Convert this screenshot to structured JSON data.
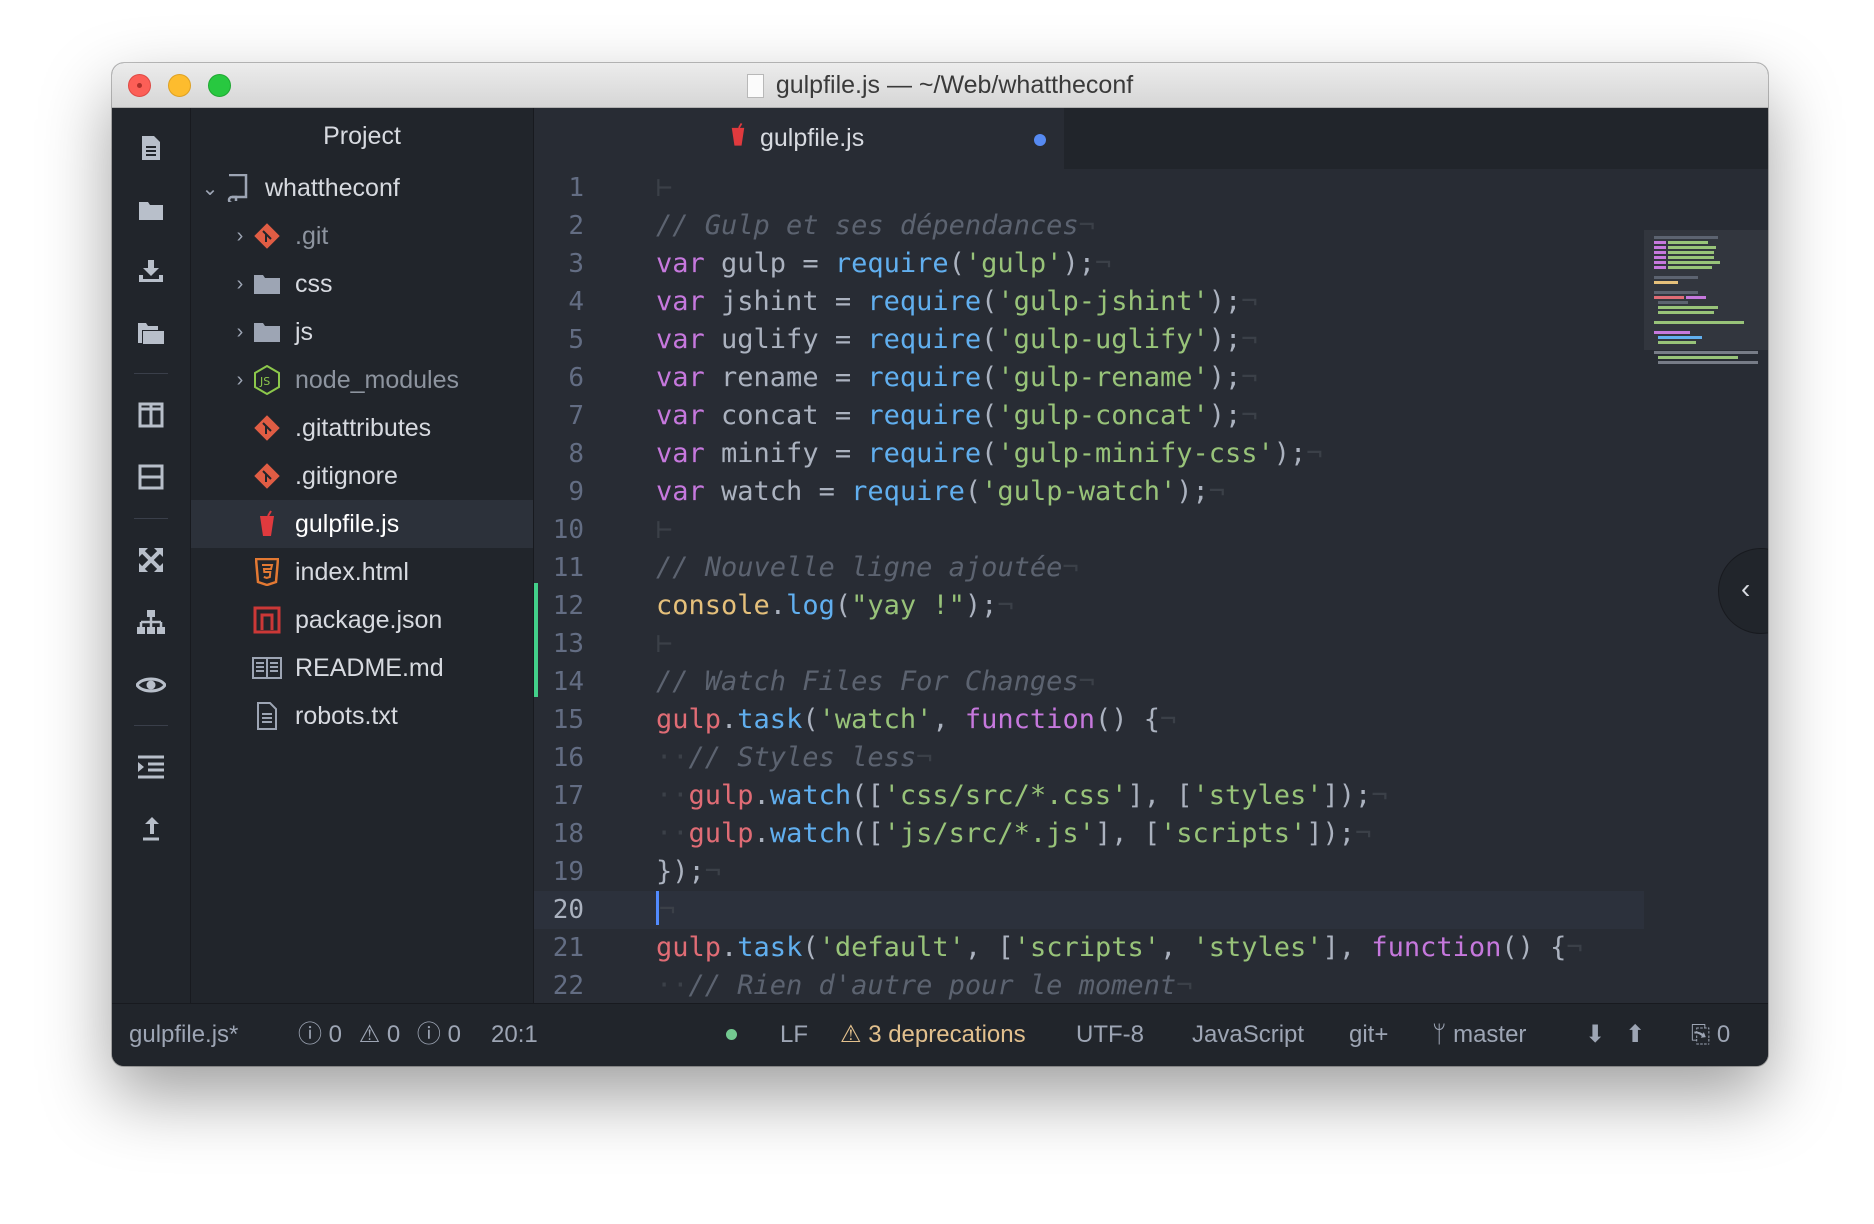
{
  "window": {
    "title": "gulpfile.js — ~/Web/whattheconf"
  },
  "tree": {
    "header": "Project",
    "root": "whattheconf",
    "items": [
      {
        "label": ".git",
        "icon": "git-repo-icon"
      },
      {
        "label": "css",
        "icon": "folder-icon"
      },
      {
        "label": "js",
        "icon": "folder-icon"
      },
      {
        "label": "node_modules",
        "icon": "nodejs-icon"
      },
      {
        "label": ".gitattributes",
        "icon": "git-icon"
      },
      {
        "label": ".gitignore",
        "icon": "git-icon"
      },
      {
        "label": "gulpfile.js",
        "icon": "gulp-icon"
      },
      {
        "label": "index.html",
        "icon": "html5-icon"
      },
      {
        "label": "package.json",
        "icon": "npm-icon"
      },
      {
        "label": "README.md",
        "icon": "readme-icon"
      },
      {
        "label": "robots.txt",
        "icon": "text-file-icon"
      }
    ]
  },
  "editor": {
    "tab": {
      "label": "gulpfile.js",
      "modified": true
    },
    "line_numbers": [
      "1",
      "2",
      "3",
      "4",
      "5",
      "6",
      "7",
      "8",
      "9",
      "10",
      "11",
      "12",
      "13",
      "14",
      "15",
      "16",
      "17",
      "18",
      "19",
      "20",
      "21",
      "22"
    ],
    "code": {
      "l2": "// Gulp et ses dépendances",
      "var": "var",
      "eq": " = ",
      "require": "require",
      "l3_name": " gulp",
      "l3_str": "'gulp'",
      "l4_name": " jshint",
      "l4_str": "'gulp-jshint'",
      "l5_name": " uglify",
      "l5_str": "'gulp-uglify'",
      "l6_name": " rename",
      "l6_str": "'gulp-rename'",
      "l7_name": " concat",
      "l7_str": "'gulp-concat'",
      "l8_name": " minify",
      "l8_str": "'gulp-minify-css'",
      "l9_name": " watch",
      "l9_str": "'gulp-watch'",
      "l11": "// Nouvelle ligne ajoutée",
      "l12_obj": "console",
      "l12_fn": "log",
      "l12_str": "\"yay !\"",
      "l14": "// Watch Files For Changes",
      "gulp": "gulp",
      "task": "task",
      "watch": "watch",
      "function": "function",
      "l15_str": "'watch'",
      "l16": "// Styles less",
      "l17_a": "'css/src/*.css'",
      "l17_b": "'styles'",
      "l18_a": "'js/src/*.js'",
      "l18_b": "'scripts'",
      "l19": "});",
      "l21_a": "'default'",
      "l21_b": "'scripts'",
      "l21_c": "'styles'",
      "l22": "// Rien d'autre pour le moment"
    }
  },
  "status": {
    "file": "gulpfile.js*",
    "errors": "0",
    "warnings": "0",
    "infos": "0",
    "cursor": "20:1",
    "line_ending": "LF",
    "deprecations": "3 deprecations",
    "encoding": "UTF-8",
    "grammar": "JavaScript",
    "git": "git+",
    "branch": "master",
    "pending": "0"
  },
  "colors": {
    "keyword": "#c678dd",
    "function": "#61afef",
    "string": "#98c379",
    "variable": "#e06c75",
    "comment": "#5c6370",
    "accent": "#568af2"
  }
}
